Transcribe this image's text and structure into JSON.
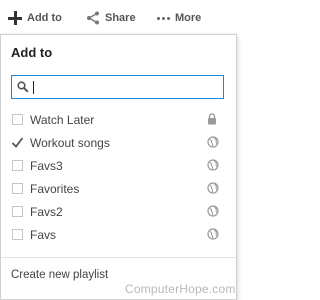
{
  "toolbar": {
    "add_label": "Add to",
    "share_label": "Share",
    "more_label": "More"
  },
  "panel": {
    "title": "Add to",
    "search": {
      "value": "",
      "placeholder": ""
    },
    "playlists": [
      {
        "name": "Watch Later",
        "checked": false,
        "privacy_icon": "lock-icon"
      },
      {
        "name": "Workout songs",
        "checked": true,
        "privacy_icon": "globe-icon"
      },
      {
        "name": "Favs3",
        "checked": false,
        "privacy_icon": "globe-icon"
      },
      {
        "name": "Favorites",
        "checked": false,
        "privacy_icon": "globe-icon"
      },
      {
        "name": "Favs2",
        "checked": false,
        "privacy_icon": "globe-icon"
      },
      {
        "name": "Favs",
        "checked": false,
        "privacy_icon": "globe-icon"
      }
    ],
    "create_label": "Create new playlist"
  },
  "watermark": "ComputerHope.com",
  "colors": {
    "accent": "#1b87d6",
    "icon_gray": "#9a9a9a"
  }
}
